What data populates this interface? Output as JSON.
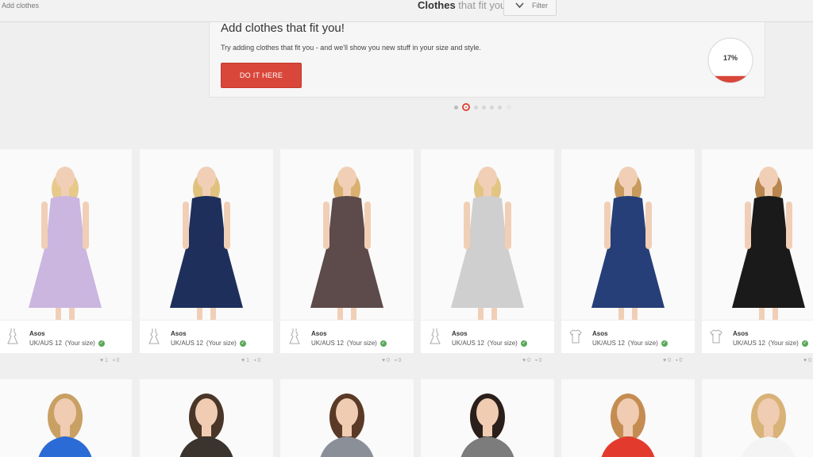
{
  "header": {
    "add_link": "Add clothes",
    "title_bold": "Clothes",
    "title_light": "that fit you",
    "filter_label": "Filter"
  },
  "promo": {
    "title": "Add clothes that fit you!",
    "text": "Try adding clothes that fit you - and we'll show you new stuff in your size and style.",
    "button_label": "DO IT HERE",
    "progress_label": "17%",
    "progress_value": 0.17
  },
  "colors": {
    "accent": "#d9463a",
    "check": "#5aa85a"
  },
  "products": [
    {
      "brand": "Asos",
      "size": "UK/AUS 12",
      "size_note": "(Your size)",
      "likes": "1",
      "comments": "0",
      "garment_icon": "dress-icon",
      "dress_color": "#cbb6e0"
    },
    {
      "brand": "Asos",
      "size": "UK/AUS 12",
      "size_note": "(Your size)",
      "likes": "1",
      "comments": "0",
      "garment_icon": "dress-icon",
      "dress_color": "#1f2f5c"
    },
    {
      "brand": "Asos",
      "size": "UK/AUS 12",
      "size_note": "(Your size)",
      "likes": "0",
      "comments": "0",
      "garment_icon": "dress-icon",
      "dress_color": "#5d4a4a"
    },
    {
      "brand": "Asos",
      "size": "UK/AUS 12",
      "size_note": "(Your size)",
      "likes": "0",
      "comments": "0",
      "garment_icon": "dress-icon",
      "dress_color": "#cfcfcf"
    },
    {
      "brand": "Asos",
      "size": "UK/AUS 12",
      "size_note": "(Your size)",
      "likes": "0",
      "comments": "0",
      "garment_icon": "tshirt-icon",
      "dress_color": "#263f78"
    },
    {
      "brand": "Asos",
      "size": "UK/AUS 12",
      "size_note": "(Your size)",
      "likes": "0",
      "comments": "0",
      "garment_icon": "tshirt-icon",
      "dress_color": "#1a1a1a"
    }
  ],
  "row2_colors": [
    "#2b6bd6",
    "#3a332e",
    "#8a8f98",
    "#7c7c7c",
    "#e23b2d",
    "#f4f4f4"
  ]
}
